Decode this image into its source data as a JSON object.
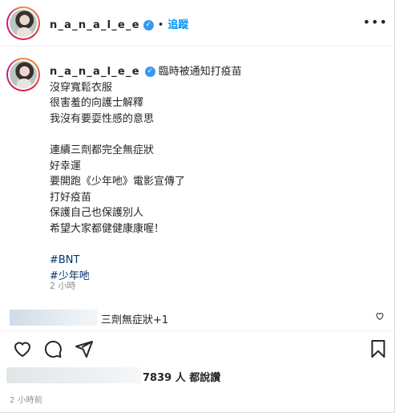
{
  "post": {
    "username": "n_a_n_a_l_e_e",
    "verified_glyph": "✓",
    "separator": "•",
    "follow_label": "追蹤",
    "more_glyph": "•••",
    "avatar_icon": "avatar-icon"
  },
  "caption": {
    "username": "n_a_n_a_l_e_e",
    "verified_glyph": "✓",
    "first_line": "臨時被通知打疫苗",
    "lines": [
      "沒穿寬鬆衣服",
      "很害羞的向護士解釋",
      "我沒有要耍性感的意思",
      "",
      "連續三劑都完全無症狀",
      "好幸運",
      "要開跑《少年吔》電影宣傳了",
      "打好疫苗",
      "保護自己也保護別人",
      "希望大家都健健康康喔！",
      ""
    ],
    "hashtags": [
      "#BNT",
      "#少年吔"
    ],
    "time": "2 小時"
  },
  "comment": {
    "text": "三劑無症狀+1",
    "more_icon": "heart-outline-small-icon"
  },
  "actions": {
    "icons": [
      "heart-icon",
      "comment-icon",
      "share-icon",
      "bookmark-icon"
    ]
  },
  "likes": {
    "text": "7839 人 都說讚"
  },
  "footer": {
    "time": "2 小時前"
  }
}
